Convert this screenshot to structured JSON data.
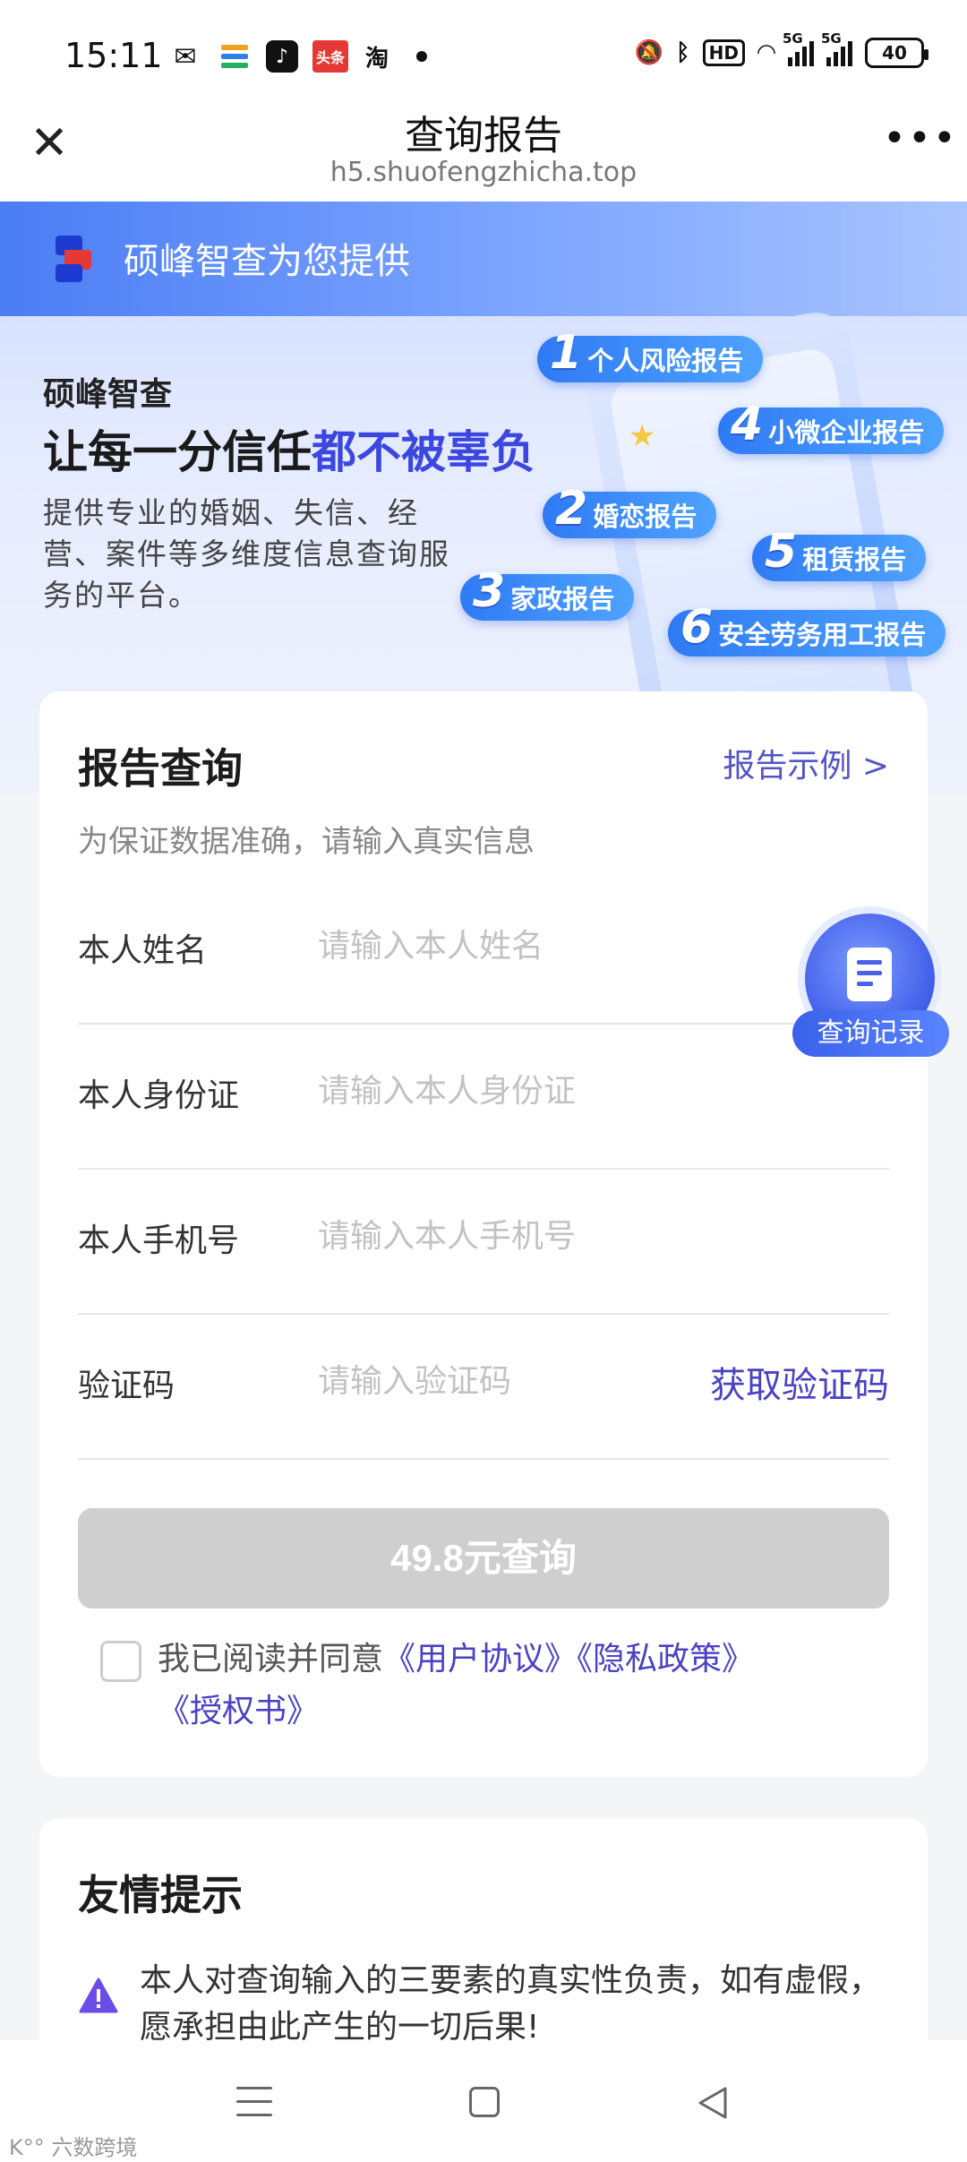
{
  "status_bar": {
    "time": "15:11",
    "left_icons": [
      "wechat-icon",
      "card-icon",
      "tiktok-icon",
      "toutiao-icon",
      "taobao-icon",
      "dot-icon"
    ],
    "toutiao_label": "头条",
    "taobao_label": "淘",
    "hd_label": "HD",
    "network_labels": [
      "5G",
      "5G"
    ],
    "battery": "40"
  },
  "titlebar": {
    "close_glyph": "✕",
    "title": "查询报告",
    "url": "h5.shuofengzhicha.top",
    "more_glyph": "•••"
  },
  "hero": {
    "provider_text": "硕峰智查为您提供",
    "brand": "硕峰智查",
    "slogan_plain": "让每一分信任",
    "slogan_highlight": "都不被辜负",
    "description": "提供专业的婚姻、失信、经营、案件等多维度信息查询服务的平台。",
    "tags": [
      {
        "num": "1",
        "label": "个人风险报告"
      },
      {
        "num": "4",
        "label": "小微企业报告"
      },
      {
        "num": "2",
        "label": "婚恋报告"
      },
      {
        "num": "5",
        "label": "租赁报告"
      },
      {
        "num": "3",
        "label": "家政报告"
      },
      {
        "num": "6",
        "label": "安全劳务用工报告"
      }
    ]
  },
  "query": {
    "title": "报告查询",
    "example_link": "报告示例 >",
    "subtitle": "为保证数据准确，请输入真实信息",
    "fields": [
      {
        "label": "本人姓名",
        "placeholder": "请输入本人姓名",
        "value": ""
      },
      {
        "label": "本人身份证",
        "placeholder": "请输入本人身份证",
        "value": ""
      },
      {
        "label": "本人手机号",
        "placeholder": "请输入本人手机号",
        "value": ""
      },
      {
        "label": "验证码",
        "placeholder": "请输入验证码",
        "value": ""
      }
    ],
    "get_code": "获取验证码",
    "submit": "49.8元查询",
    "agree_prefix": "我已阅读并同意",
    "links": [
      "《用户协议》",
      "《隐私政策》",
      "《授权书》"
    ],
    "checked": false
  },
  "float_button": {
    "label": "查询记录",
    "icon": "document-edit-icon"
  },
  "tips": {
    "title": "友情提示",
    "icon": "warning-icon",
    "text": "本人对查询输入的三要素的真实性负责，如有虚假，愿承担由此产生的一切后果!"
  },
  "navbar": {
    "icons": [
      "menu-icon",
      "home-icon",
      "back-icon"
    ]
  },
  "watermark": "K°° 六数跨境",
  "colors": {
    "accent": "#4a42c4",
    "brand_blue": "#3c46e0",
    "button_disabled": "#cfcfcf"
  }
}
